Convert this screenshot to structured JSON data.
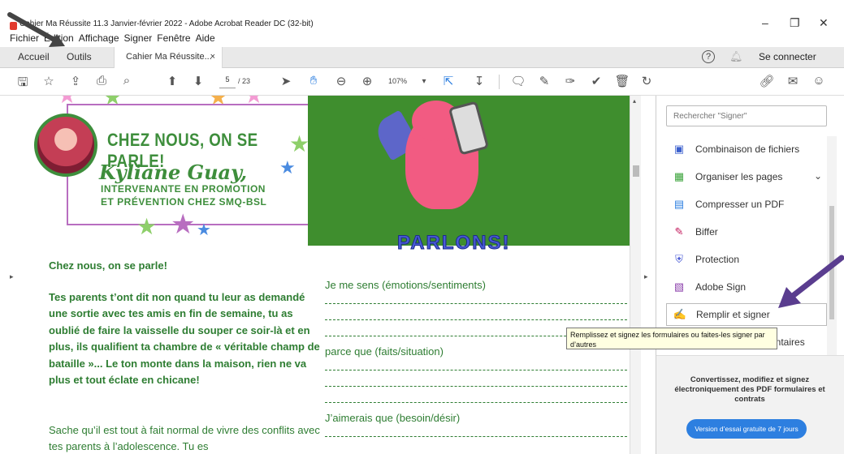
{
  "window": {
    "title": "Cahier Ma Réussite  11.3  Janvier-février 2022 - Adobe Acrobat Reader DC (32-bit)",
    "minimize": "–",
    "maximize": "❐",
    "close": "✕"
  },
  "menu": [
    "Fichier",
    "Édition",
    "Affichage",
    "Signer",
    "Fenêtre",
    "Aide"
  ],
  "tabs": {
    "home": "Accueil",
    "tools": "Outils",
    "document": "Cahier Ma Réussite...",
    "close": "×"
  },
  "header_right": {
    "help": "?",
    "signin": "Se connecter"
  },
  "toolbar": {
    "page_current": "5",
    "page_total": "/ 23",
    "zoom": "107%"
  },
  "document": {
    "card_title": "CHEZ NOUS, ON SE PARLE!",
    "card_name": "Kyliane Guay,",
    "card_role_1": "INTERVENANTE EN PROMOTION",
    "card_role_2": "ET PRÉVENTION CHEZ SMQ-BSL",
    "banner": "PARLONS!",
    "lead": "Chez nous, on se parle!",
    "body_bold": "Tes parents t’ont dit non quand tu leur as demandé une sortie avec tes amis en fin de semaine, tu as oublié de faire la vaisselle du souper ce soir-là et en plus, ils qualifient ta chambre de « véritable champ de bataille »... Le ton monte dans la maison, rien ne va plus et tout éclate en chicane!",
    "body_plain": "Sache qu’il est tout à fait normal de vivre des conflits avec tes parents à l’adolescence. Tu es",
    "label_feel": "Je me sens (émotions/sentiments)",
    "label_because": "parce que (faits/situation)",
    "label_wish": "J’aimerais que (besoin/désir)"
  },
  "tools_pane": {
    "search_placeholder": "Rechercher \"Signer\"",
    "items": [
      {
        "label": "Combinaison de fichiers",
        "icon": "combine-files-icon",
        "color": "#3a5fcd"
      },
      {
        "label": "Organiser les pages",
        "icon": "organize-pages-icon",
        "color": "#3aa33a"
      },
      {
        "label": "Compresser un PDF",
        "icon": "compress-pdf-icon",
        "color": "#2d7fe0"
      },
      {
        "label": "Biffer",
        "icon": "redact-icon",
        "color": "#c2185b"
      },
      {
        "label": "Protection",
        "icon": "shield-icon",
        "color": "#4a5bd6"
      },
      {
        "label": "Adobe Sign",
        "icon": "adobe-sign-icon",
        "color": "#8e44ad"
      },
      {
        "label": "Remplir et signer",
        "icon": "fill-sign-icon",
        "color": "#8e44ad"
      },
      {
        "label": "Commentaires",
        "icon": "comment-icon",
        "color": "#e0a800"
      }
    ],
    "partial_item": "entaires",
    "promo_text": "Convertissez, modifiez et signez électroniquement des PDF formulaires et contrats",
    "promo_button": "Version d’essai gratuite de 7 jours"
  },
  "tooltip": "Remplissez et signez les formulaires ou faites-les signer par d’autres"
}
